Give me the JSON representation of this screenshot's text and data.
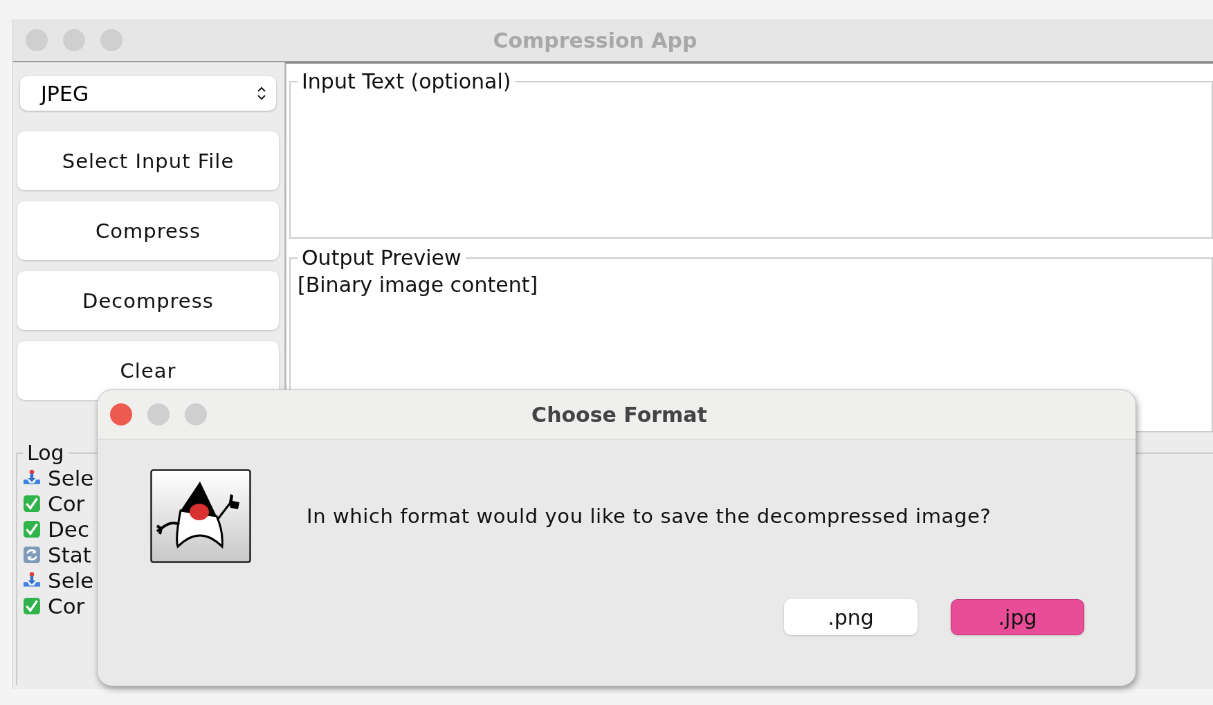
{
  "window": {
    "title": "Compression App"
  },
  "format_select": {
    "value": "JPEG"
  },
  "buttons": [
    "Select Input File",
    "Compress",
    "Decompress",
    "Clear"
  ],
  "input_panel": {
    "title": "Input Text (optional)"
  },
  "output_panel": {
    "title": "Output Preview",
    "content": "[Binary image content]"
  },
  "log": {
    "title": "Log",
    "entries": [
      {
        "kind": "select",
        "text": "Sele"
      },
      {
        "kind": "check",
        "text": "Cor"
      },
      {
        "kind": "check",
        "text": "Dec"
      },
      {
        "kind": "refresh",
        "text": "Stat"
      },
      {
        "kind": "select",
        "text": "Sele"
      },
      {
        "kind": "check",
        "text": "Cor"
      }
    ]
  },
  "dialog": {
    "title": "Choose Format",
    "message": "In which format would you like to save the decompressed image?",
    "options": [
      {
        "label": ".png",
        "selected": false
      },
      {
        "label": ".jpg",
        "selected": true
      }
    ]
  }
}
